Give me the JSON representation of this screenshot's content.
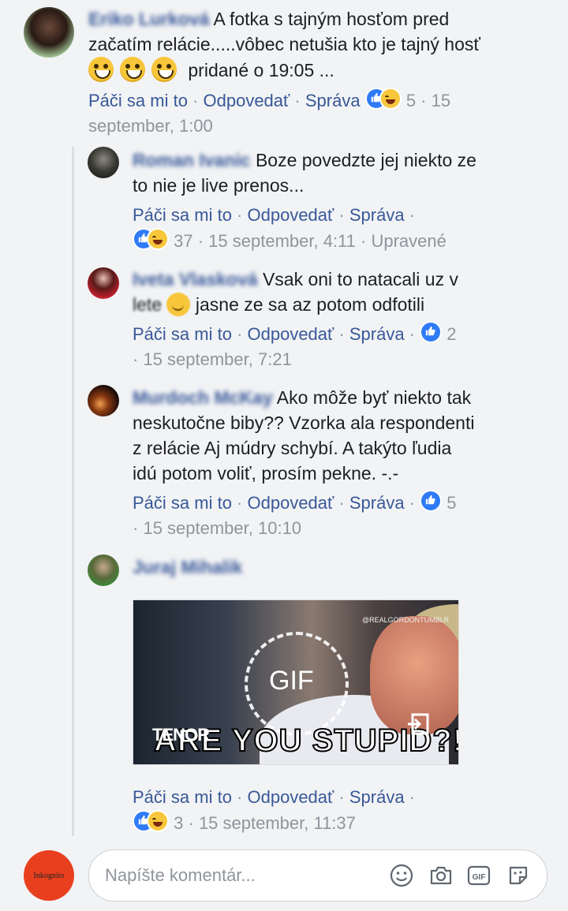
{
  "actions": {
    "like": "Páči sa mi to",
    "reply": "Odpovedať",
    "message": "Správa",
    "sep": " · "
  },
  "comments": [
    {
      "name": "Eriko Lurková",
      "text_a": "A fotka s tajným hosťom pred",
      "text_b": "začatím relácie.....vôbec netušia kto je tajný hosť",
      "text_c": "pridané o 19:05 ...",
      "count": "5",
      "time": "15",
      "time2": "september, 1:00"
    },
    {
      "name": "Roman Ivanic",
      "text_a": "Boze povedzte jej niekto ze",
      "text_b": "to nie je live prenos...",
      "count": "37",
      "time": "15 september, 4:11",
      "edited": "Upravené"
    },
    {
      "name": "Iveta Vlasková",
      "text_a": "Vsak oni to natacali uz v",
      "text_b": "lete",
      "text_c": "jasne ze sa az potom odfotili",
      "count": "2",
      "time": "15 september, 7:21"
    },
    {
      "name": "Murdoch McKay",
      "text_a": "Ako môže byť niekto tak",
      "text_b": "neskutočne biby?? Vzorka ala respondenti",
      "text_c": "z relácie Aj múdry schybí. A takýto ľudia",
      "text_d": "idú potom voliť, prosím pekne. -.-",
      "count": "5",
      "time": "15 september, 10:10"
    },
    {
      "name": "Juraj Mihalik",
      "gif_label": "GIF",
      "gif_brand": "TENOR",
      "gif_caption": "ARE YOU STUPID?!",
      "gif_watermark": "@REALGORDONTUMBLR",
      "count": "3",
      "time": "15 september, 11:37"
    }
  ],
  "composer": {
    "placeholder": "Napíšte komentár...",
    "avatar_text": "Inkognito"
  },
  "colors": {
    "link": "#385898",
    "meta": "#90949c",
    "like": "#2f7bf7",
    "accent_avatar": "#e8401f"
  }
}
